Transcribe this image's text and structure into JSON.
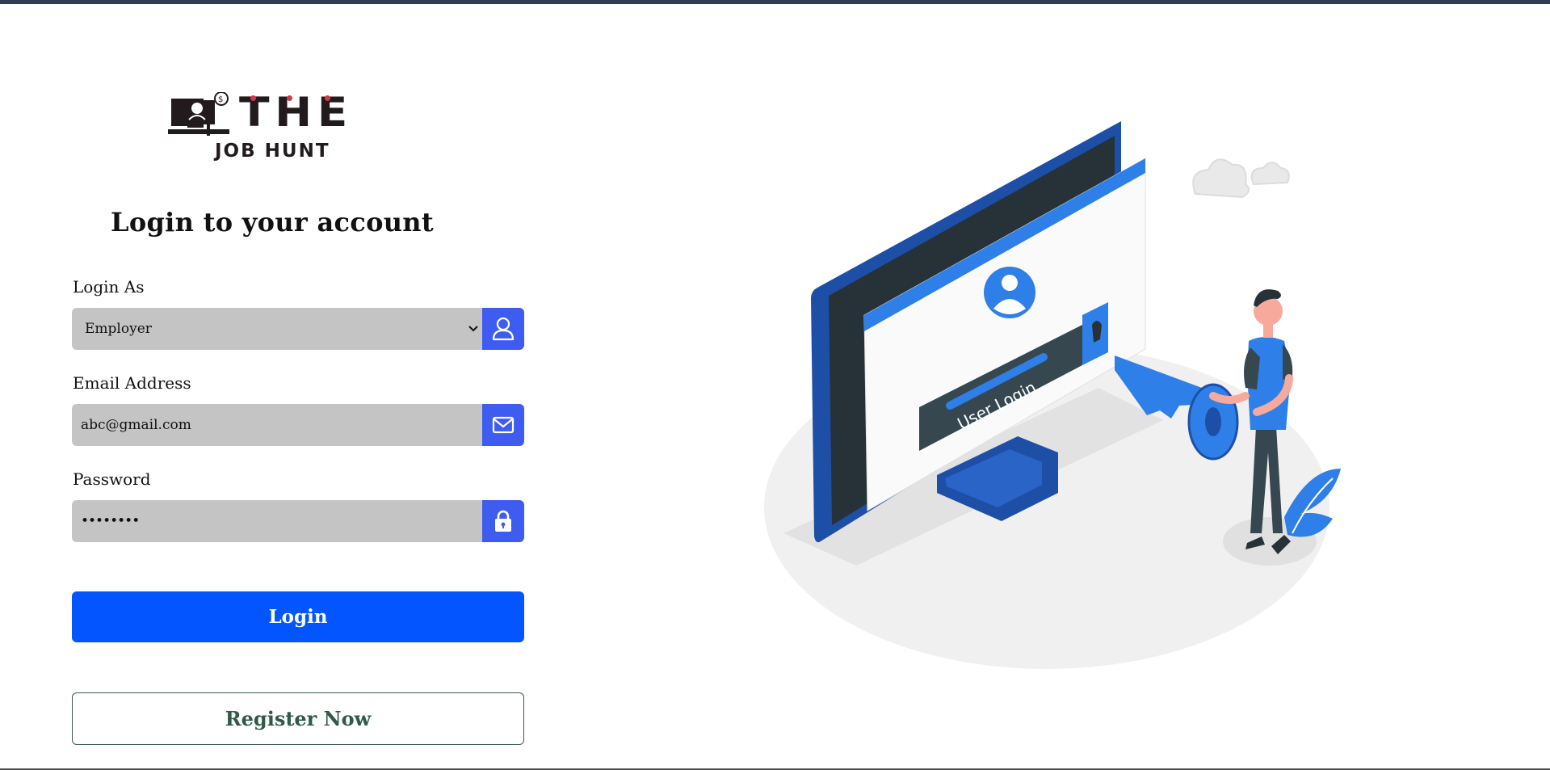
{
  "logo": {
    "the_text": "THE",
    "sub_text": "JOB HUNT"
  },
  "form": {
    "title": "Login to your account",
    "login_as": {
      "label": "Login As",
      "value": "Employer",
      "icon": "user-icon"
    },
    "email": {
      "label": "Email Address",
      "value": "abc@gmail.com",
      "icon": "envelope-icon"
    },
    "password": {
      "label": "Password",
      "value": "••••••••",
      "icon": "lock-icon"
    },
    "login_button": "Login",
    "register_button": "Register Now"
  },
  "illustration": {
    "screen_text": "User Login"
  },
  "colors": {
    "primary": "#0255ff",
    "addon": "#3e5cf0",
    "field_bg": "#c4c4c4",
    "register_text": "#2f5a46",
    "illustration_blue": "#2f7fe8"
  }
}
